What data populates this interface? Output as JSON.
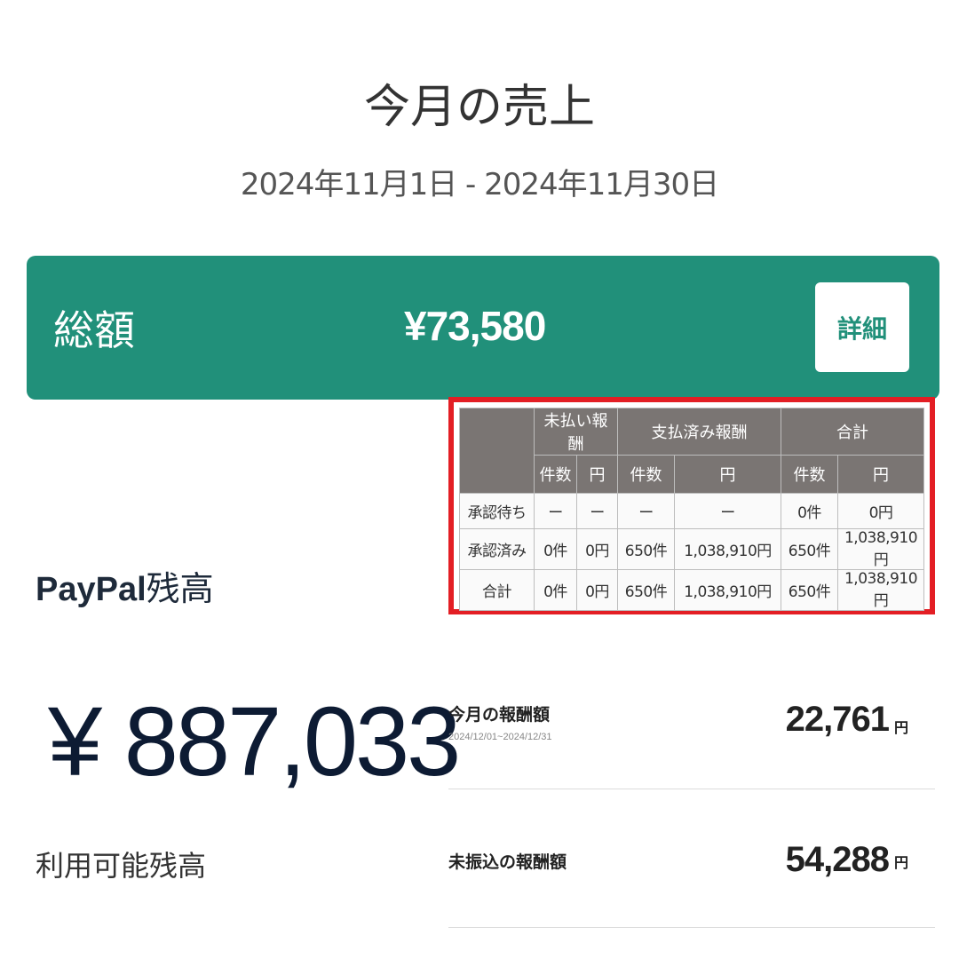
{
  "header": {
    "title": "今月の売上",
    "period": "2024年11月1日 - 2024年11月30日"
  },
  "total": {
    "label": "総額",
    "value": "¥73,580",
    "detail_button": "詳細"
  },
  "summary_table": {
    "group_headers": [
      "",
      "未払い報酬",
      "支払済み報酬",
      "合計"
    ],
    "sub_headers": [
      "件数",
      "円",
      "件数",
      "円",
      "件数",
      "円"
    ],
    "rows": [
      {
        "label": "承認待ち",
        "cells": [
          "ー",
          "ー",
          "ー",
          "ー",
          "0件",
          "0円"
        ]
      },
      {
        "label": "承認済み",
        "cells": [
          "0件",
          "0円",
          "650件",
          "1,038,910円",
          "650件",
          "1,038,910円"
        ]
      },
      {
        "label": "合計",
        "cells": [
          "0件",
          "0円",
          "650件",
          "1,038,910円",
          "650件",
          "1,038,910円"
        ]
      }
    ],
    "highlight_color": "#e31e24"
  },
  "paypal": {
    "brand": "PayPal",
    "title_suffix": "残高",
    "amount": "¥ 887,033",
    "subtitle": "利用可能残高"
  },
  "rewards": {
    "this_month": {
      "label": "今月の報酬額",
      "range": "2024/12/01~2024/12/31",
      "amount": "22,761",
      "unit": "円"
    },
    "untransferred": {
      "label": "未振込の報酬額",
      "amount": "54,288",
      "unit": "円"
    }
  },
  "colors": {
    "accent": "#21907a",
    "table_header": "#7a7573"
  }
}
